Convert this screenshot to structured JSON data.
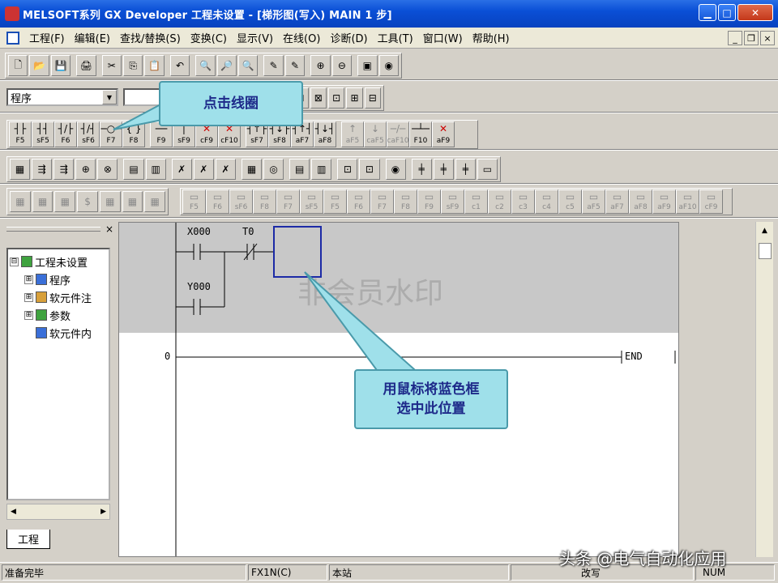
{
  "window": {
    "title": "MELSOFT系列 GX Developer 工程未设置 - [梯形图(写入)    MAIN    1 步]",
    "minimize": "▁",
    "maximize": "□",
    "close": "✕"
  },
  "menu": [
    "工程(F)",
    "编辑(E)",
    "查找/替换(S)",
    "变换(C)",
    "显示(V)",
    "在线(O)",
    "诊断(D)",
    "工具(T)",
    "窗口(W)",
    "帮助(H)"
  ],
  "mdi": {
    "minimize": "_",
    "restore": "❐",
    "close": "×"
  },
  "toolbar1": [
    "🗋",
    "📂",
    "💾",
    "🖨",
    "✂",
    "⎘",
    "📋",
    "↶",
    "🔍",
    "🔎",
    "🔍",
    "✎",
    "✎",
    "⊕",
    "⊖",
    "▣",
    "◉"
  ],
  "program_combo": {
    "value": "程序",
    "arrow": "▼"
  },
  "toolbar2_icons": [
    "⊞",
    "⊟",
    "⊠",
    "⊡",
    "⊞",
    "⊟"
  ],
  "fkeys": [
    {
      "sym": "┤├",
      "key": "F5"
    },
    {
      "sym": "┤┤",
      "key": "sF5"
    },
    {
      "sym": "┤/├",
      "key": "F6"
    },
    {
      "sym": "┤/┤",
      "key": "sF6"
    },
    {
      "sym": "─○─",
      "key": "F7"
    },
    {
      "sym": "{ }",
      "key": "F8"
    },
    {
      "sym": "──",
      "key": "F9"
    },
    {
      "sym": "│",
      "key": "sF9"
    },
    {
      "sym": "✕",
      "key": "cF9"
    },
    {
      "sym": "✕",
      "key": "cF10"
    },
    {
      "sym": "┤↑├",
      "key": "sF7"
    },
    {
      "sym": "┤↓├",
      "key": "sF8"
    },
    {
      "sym": "┤↑┤",
      "key": "aF7"
    },
    {
      "sym": "┤↓┤",
      "key": "aF8"
    },
    {
      "sym": "↑",
      "key": "aF5"
    },
    {
      "sym": "↓",
      "key": "caF5"
    },
    {
      "sym": "─/─",
      "key": "caF10"
    },
    {
      "sym": "─┴─",
      "key": "F10"
    },
    {
      "sym": "✕",
      "key": "aF9"
    }
  ],
  "toolbar4": [
    "▦",
    "⇶",
    "⇶",
    "⊕",
    "⊗",
    "▤",
    "▥",
    "✗",
    "✗",
    "✗",
    "▦",
    "◎",
    "▤",
    "▥",
    "⊡",
    "⊡",
    "◉",
    "╪",
    "╪",
    "╪",
    "▭"
  ],
  "toolbar5_left": [
    "▦",
    "▦",
    "▦",
    "$",
    "▦",
    "▦",
    "▦"
  ],
  "toolbar5_keys": [
    "F5",
    "F6",
    "sF6",
    "F8",
    "F7",
    "sF5",
    "F5",
    "F6",
    "F7",
    "F8",
    "F9",
    "sF9",
    "c1",
    "c2",
    "c3",
    "c4",
    "c5",
    "aF5",
    "aF7",
    "aF8",
    "aF9",
    "aF10",
    "cF9"
  ],
  "pane": {
    "close": "×",
    "tab_label": "工程",
    "scroll_left": "◀",
    "scroll_right": "▶"
  },
  "tree": [
    {
      "label": "工程未设置",
      "expander": "⊟",
      "indent": 0,
      "icon_color": "#3fa33f"
    },
    {
      "label": "程序",
      "expander": "⊞",
      "indent": 1,
      "icon_color": "#3a6fd8"
    },
    {
      "label": "软元件注",
      "expander": "⊞",
      "indent": 1,
      "icon_color": "#d8a03a"
    },
    {
      "label": "参数",
      "expander": "⊞",
      "indent": 1,
      "icon_color": "#3fa33f"
    },
    {
      "label": "软元件内",
      "expander": "",
      "indent": 1,
      "icon_color": "#3a6fd8"
    }
  ],
  "ladder": {
    "contacts": [
      {
        "device": "X000",
        "type": "NO"
      },
      {
        "device": "T0",
        "type": "NC"
      },
      {
        "device": "Y000",
        "type": "NO"
      }
    ],
    "step_number": "0",
    "end_label": "END",
    "watermark": "非会员水印"
  },
  "callouts": {
    "coil": "点击线圈",
    "select": "用鼠标将蓝色框\n选中此位置"
  },
  "status": {
    "ready": "准备完毕",
    "cpu": "FX1N(C)",
    "station": "本站",
    "mode": "改写",
    "numlock": "NUM"
  },
  "credit": "头条 @电气自动化应用",
  "colors": {
    "titlebar": "#0a4fd6",
    "callout": "#9fe0ea",
    "cursor": "#1c2aa6",
    "rung_bg": "#c8c8c8"
  }
}
